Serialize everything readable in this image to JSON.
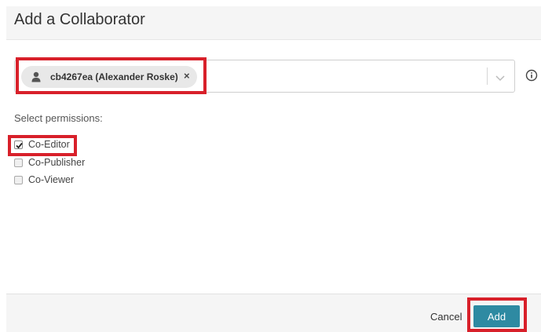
{
  "dialog": {
    "title": "Add a Collaborator"
  },
  "collaborator_select": {
    "chip_label": "cb4267ea (Alexander Roske)",
    "chip_remove": "×",
    "icon": "user-icon",
    "dropdown_icon": "chevron-down-icon",
    "info_icon": "info-icon"
  },
  "permissions": {
    "label": "Select permissions:",
    "options": [
      {
        "label": "Co-Editor",
        "checked": true
      },
      {
        "label": "Co-Publisher",
        "checked": false
      },
      {
        "label": "Co-Viewer",
        "checked": false
      }
    ]
  },
  "footer": {
    "cancel_label": "Cancel",
    "add_label": "Add"
  },
  "colors": {
    "accent": "#2e8aa2",
    "highlight": "#d8202a",
    "chip_bg": "#e8e8e8"
  }
}
